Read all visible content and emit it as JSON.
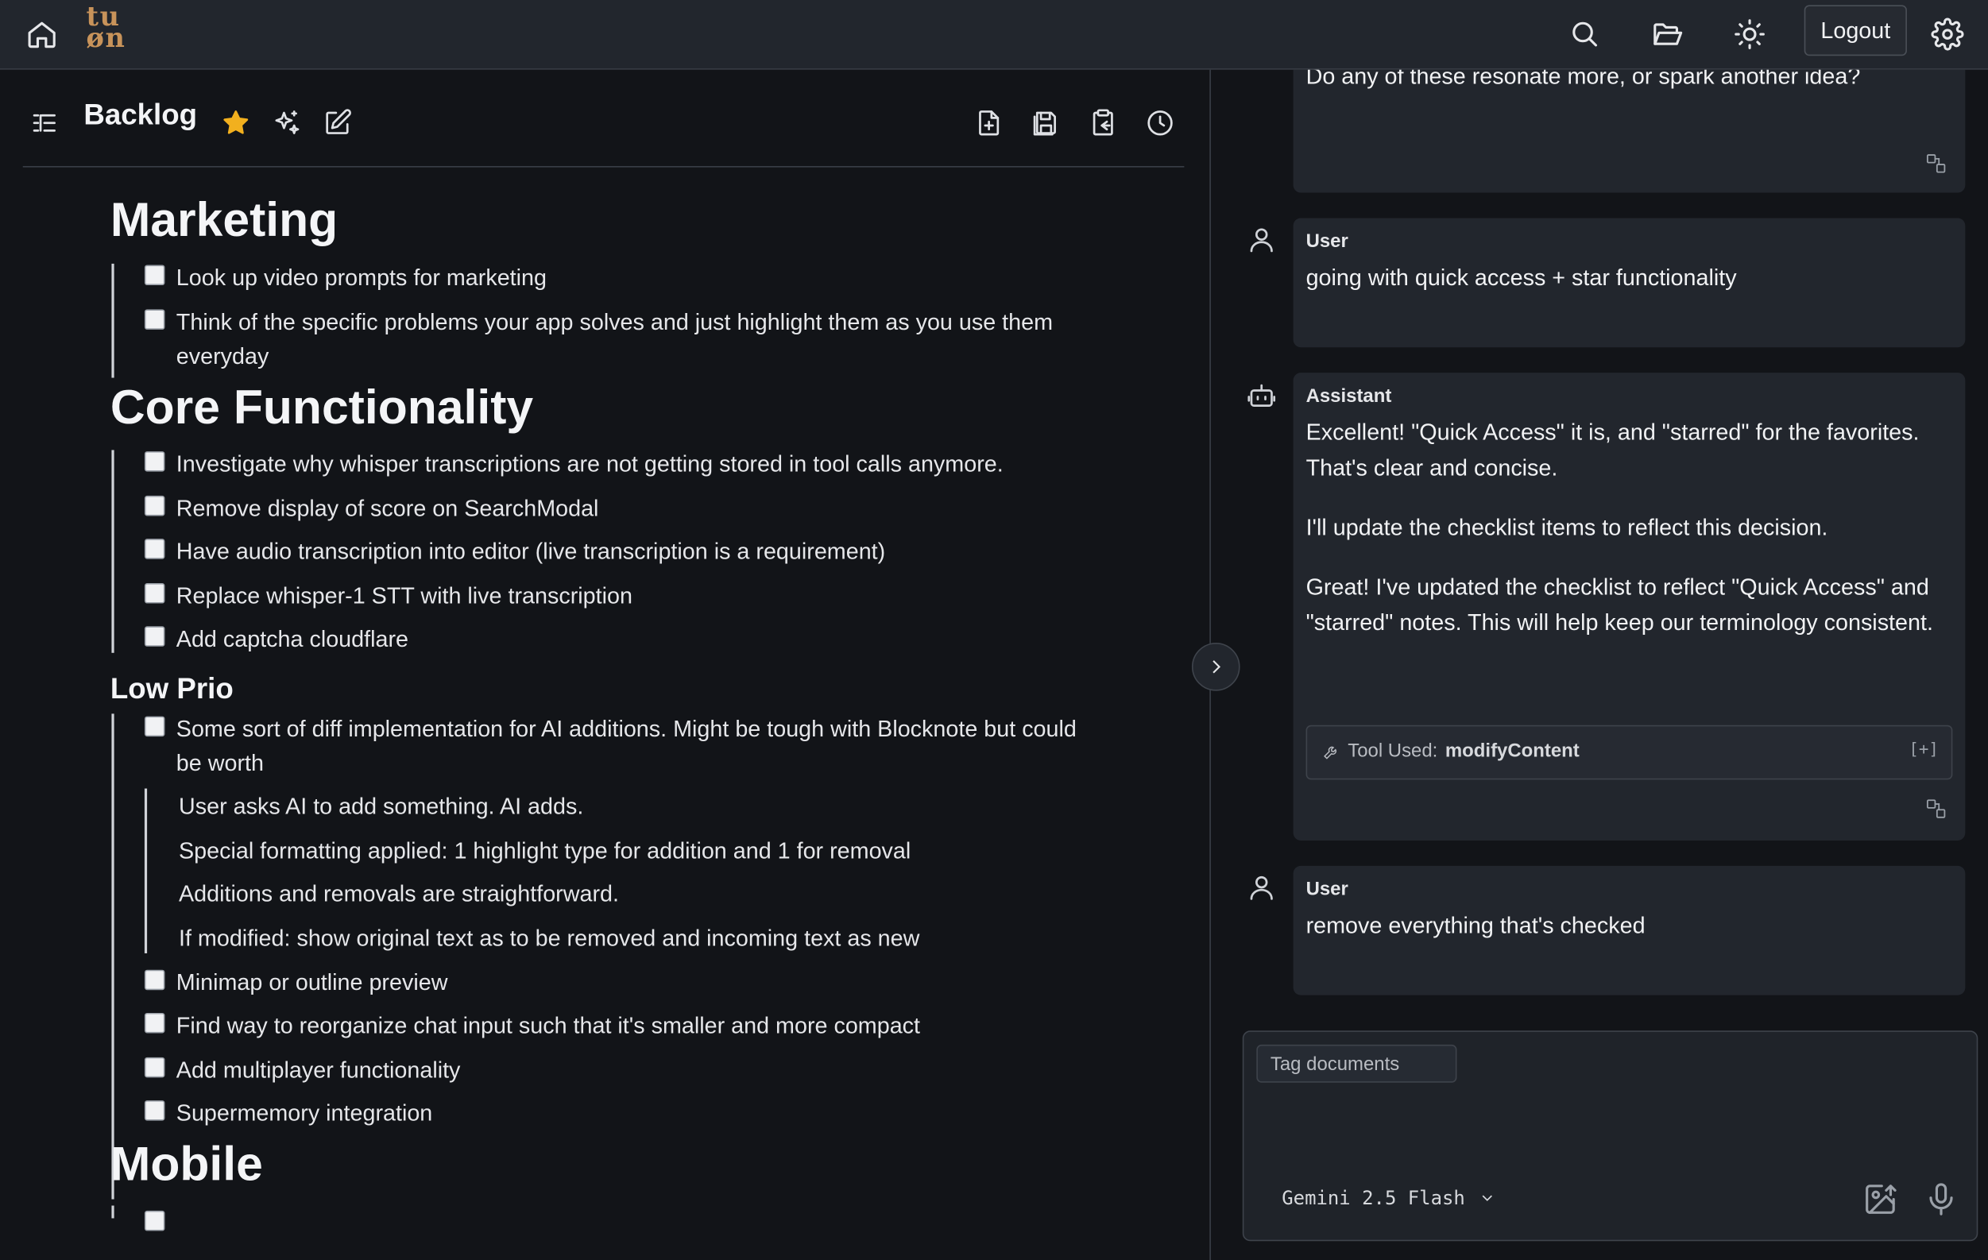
{
  "app": {
    "logo": "tu\nøn",
    "logout_label": "Logout"
  },
  "document": {
    "title": "Backlog",
    "sections": {
      "marketing": {
        "heading": "Marketing",
        "items": [
          "Look up video prompts for marketing",
          "Think of the specific problems your app solves and just highlight them as you use them everyday"
        ]
      },
      "core": {
        "heading": "Core Functionality",
        "items": [
          "Investigate why whisper transcriptions are not getting stored in tool calls anymore.",
          "Remove display of score on SearchModal",
          "Have audio transcription into editor (live transcription is a requirement)",
          "Replace whisper-1 STT with live transcription",
          "Add captcha cloudflare"
        ]
      },
      "lowprio": {
        "heading": "Low Prio",
        "items": [
          "Some sort of diff implementation for AI additions. Might be tough with Blocknote but could be worth",
          "Minimap or outline preview",
          "Find way to reorganize chat input such that it's smaller and more compact",
          "Add multiplayer functionality",
          "Supermemory integration"
        ],
        "sub_items": [
          "User asks AI to add something. AI adds.",
          "Special formatting applied: 1 highlight type for addition and 1 for removal",
          "Additions and removals are straightforward.",
          "If modified: show original text as to be removed and incoming text as new"
        ]
      },
      "mobile": {
        "heading": "Mobile"
      }
    }
  },
  "chat": {
    "messages": [
      {
        "role": "",
        "text": "Do any of these resonate more, or spark another idea?"
      },
      {
        "role": "User",
        "text": "going with quick access + star functionality"
      },
      {
        "role": "Assistant",
        "para1": "Excellent! \"Quick Access\" it is, and \"starred\" for the favorites. That's clear and concise.",
        "para2": "I'll update the checklist items to reflect this decision.",
        "para3": "Great! I've updated the checklist to reflect \"Quick Access\" and \"starred\" notes. This will help keep our terminology consistent.",
        "tool_prefix": "Tool Used:",
        "tool_name": "modifyContent",
        "tool_toggle": "[+]"
      },
      {
        "role": "User",
        "text": "remove everything that's checked"
      }
    ],
    "input": {
      "tag_label": "Tag documents",
      "model": "Gemini 2.5 Flash"
    }
  },
  "icons": {
    "top": [
      "home-icon",
      "search-icon",
      "folder-open-icon",
      "sun-icon",
      "gear-icon"
    ],
    "doc": [
      "outline-icon",
      "star-icon",
      "sparkles-icon",
      "edit-icon",
      "new-file-icon",
      "save-icon",
      "clipboard-icon",
      "history-icon"
    ]
  },
  "colors": {
    "accent_star": "#f2b01e",
    "logo": "#c8935a",
    "background": "#121418",
    "panel": "#22262d"
  }
}
